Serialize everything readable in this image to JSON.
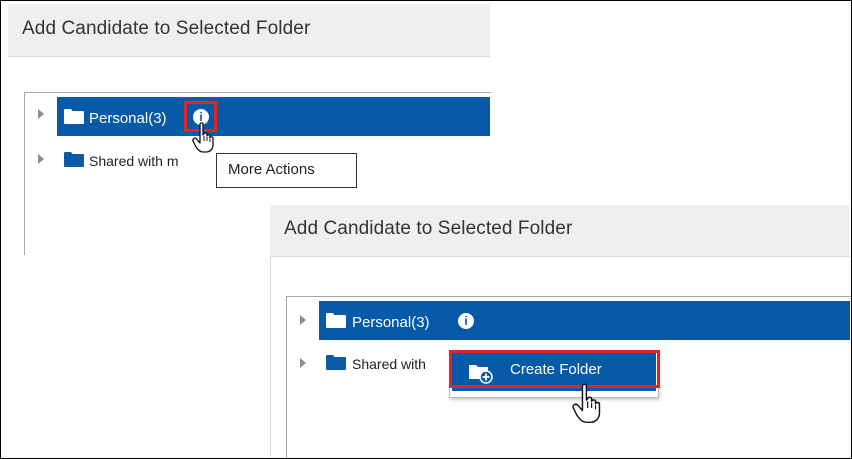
{
  "panel_back": {
    "title": "Add Candidate to Selected Folder",
    "tree": [
      {
        "label": "Personal(3)",
        "selected": true
      },
      {
        "label": "Shared with m",
        "selected": false
      }
    ]
  },
  "tooltip": {
    "text": "More Actions"
  },
  "panel_front": {
    "title": "Add Candidate to Selected Folder",
    "tree": [
      {
        "label": "Personal(3)",
        "selected": true
      },
      {
        "label": "Shared with",
        "selected": false
      }
    ]
  },
  "context_menu": {
    "items": [
      {
        "label": "Create Folder",
        "icon": "folder-add-icon"
      }
    ]
  },
  "colors": {
    "selection_blue": "#075aa8",
    "highlight_red": "#e02525",
    "header_gray": "#efefef"
  }
}
